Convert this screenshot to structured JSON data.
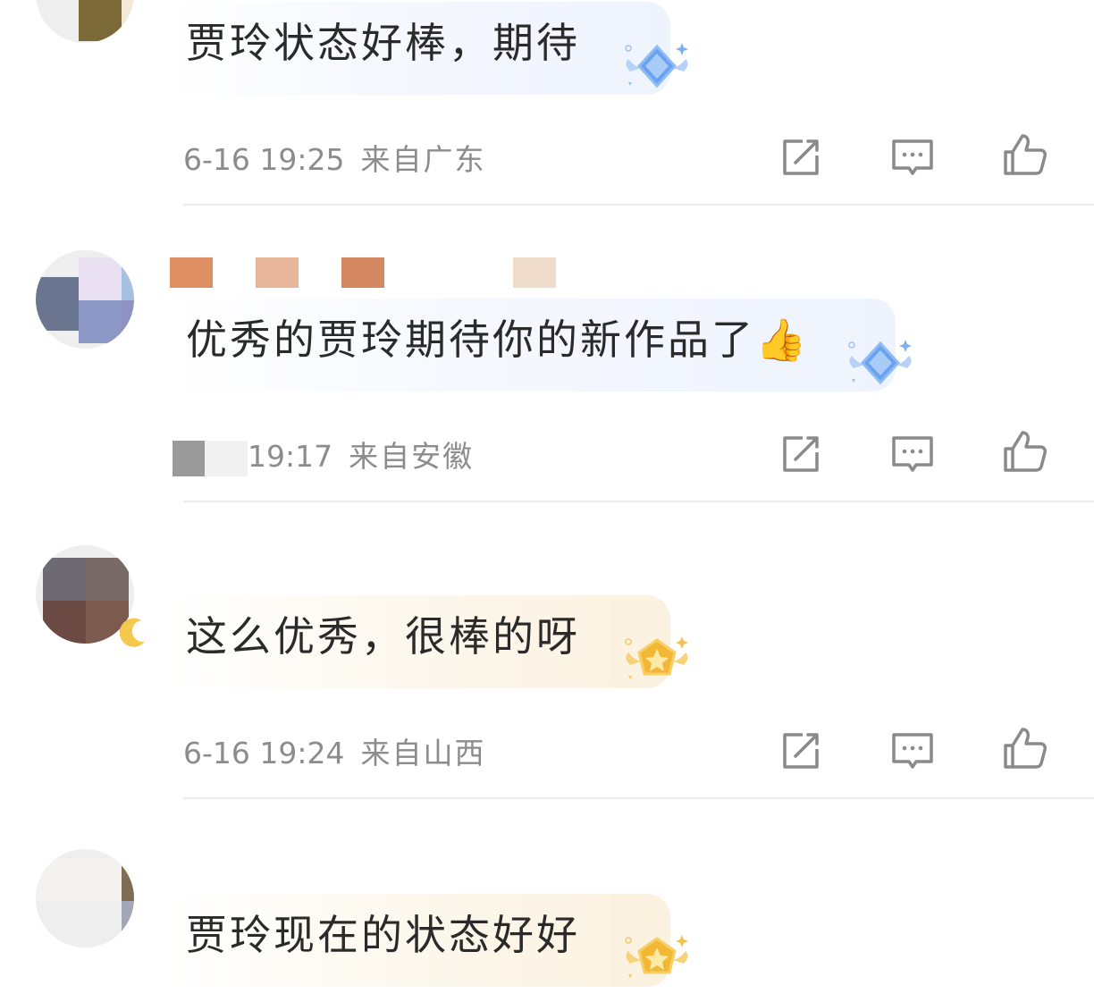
{
  "comments": [
    {
      "text": "贾玲状态好棒，期待",
      "date": "6-16 19:25",
      "location": "来自广东",
      "badge": "blue-diamond-badge"
    },
    {
      "text": "优秀的贾玲期待你的新作品了👍",
      "date": "19:17",
      "location": "来自安徽",
      "badge": "blue-diamond-badge"
    },
    {
      "text": "这么优秀，很棒的呀",
      "date": "6-16 19:24",
      "location": "来自山西",
      "badge": "gold-star-badge"
    },
    {
      "text": "贾玲现在的状态好好",
      "date": "",
      "location": "",
      "badge": "gold-star-badge"
    }
  ],
  "icons": {
    "share": "share-icon",
    "reply": "comment-icon",
    "like": "thumbs-up-icon"
  },
  "colors": {
    "text": "#2a2a2a",
    "meta": "#8c8c8c",
    "divider": "#ededed",
    "icon": "#8a8a8a"
  }
}
